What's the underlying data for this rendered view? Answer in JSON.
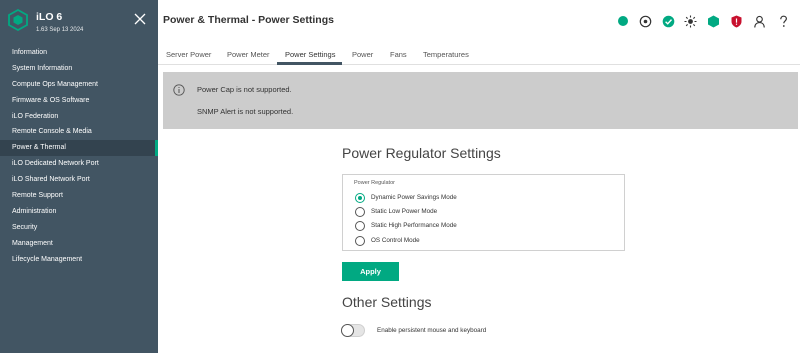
{
  "brand": {
    "title": "iLO 6",
    "subtitle": "1.63 Sep 13 2024"
  },
  "sidebar": {
    "items": [
      {
        "label": "Information"
      },
      {
        "label": "System Information"
      },
      {
        "label": "Compute Ops Management"
      },
      {
        "label": "Firmware & OS Software"
      },
      {
        "label": "iLO Federation"
      },
      {
        "label": "Remote Console & Media"
      },
      {
        "label": "Power & Thermal",
        "active": true
      },
      {
        "label": "iLO Dedicated Network Port"
      },
      {
        "label": "iLO Shared Network Port"
      },
      {
        "label": "Remote Support"
      },
      {
        "label": "Administration"
      },
      {
        "label": "Security"
      },
      {
        "label": "Management"
      },
      {
        "label": "Lifecycle Management"
      }
    ]
  },
  "header": {
    "title": "Power & Thermal - Power Settings",
    "icons": [
      "health-icon",
      "power-icon",
      "status-check-icon",
      "uid-light-icon",
      "system-health-icon",
      "security-shield-icon",
      "user-icon",
      "help-icon"
    ]
  },
  "tabs": [
    {
      "label": "Server Power"
    },
    {
      "label": "Power Meter"
    },
    {
      "label": "Power Settings",
      "active": true
    },
    {
      "label": "Power"
    },
    {
      "label": "Fans"
    },
    {
      "label": "Temperatures"
    }
  ],
  "banner": {
    "line1": "Power Cap is not supported.",
    "line2": "SNMP Alert is not supported."
  },
  "power_regulator": {
    "section_title": "Power Regulator Settings",
    "legend": "Power Regulator",
    "options": [
      {
        "label": "Dynamic Power Savings Mode",
        "selected": true
      },
      {
        "label": "Static Low Power Mode",
        "selected": false
      },
      {
        "label": "Static High Performance Mode",
        "selected": false
      },
      {
        "label": "OS Control Mode",
        "selected": false
      }
    ],
    "apply_label": "Apply"
  },
  "other_settings": {
    "section_title": "Other Settings",
    "toggle_label": "Enable persistent mouse and keyboard",
    "toggle_on": false
  },
  "colors": {
    "accent": "#01a982",
    "sidebar_bg": "#425563",
    "banner_bg": "#cccccc",
    "health_ok": "#01a982",
    "security_risk": "#c8102e"
  }
}
